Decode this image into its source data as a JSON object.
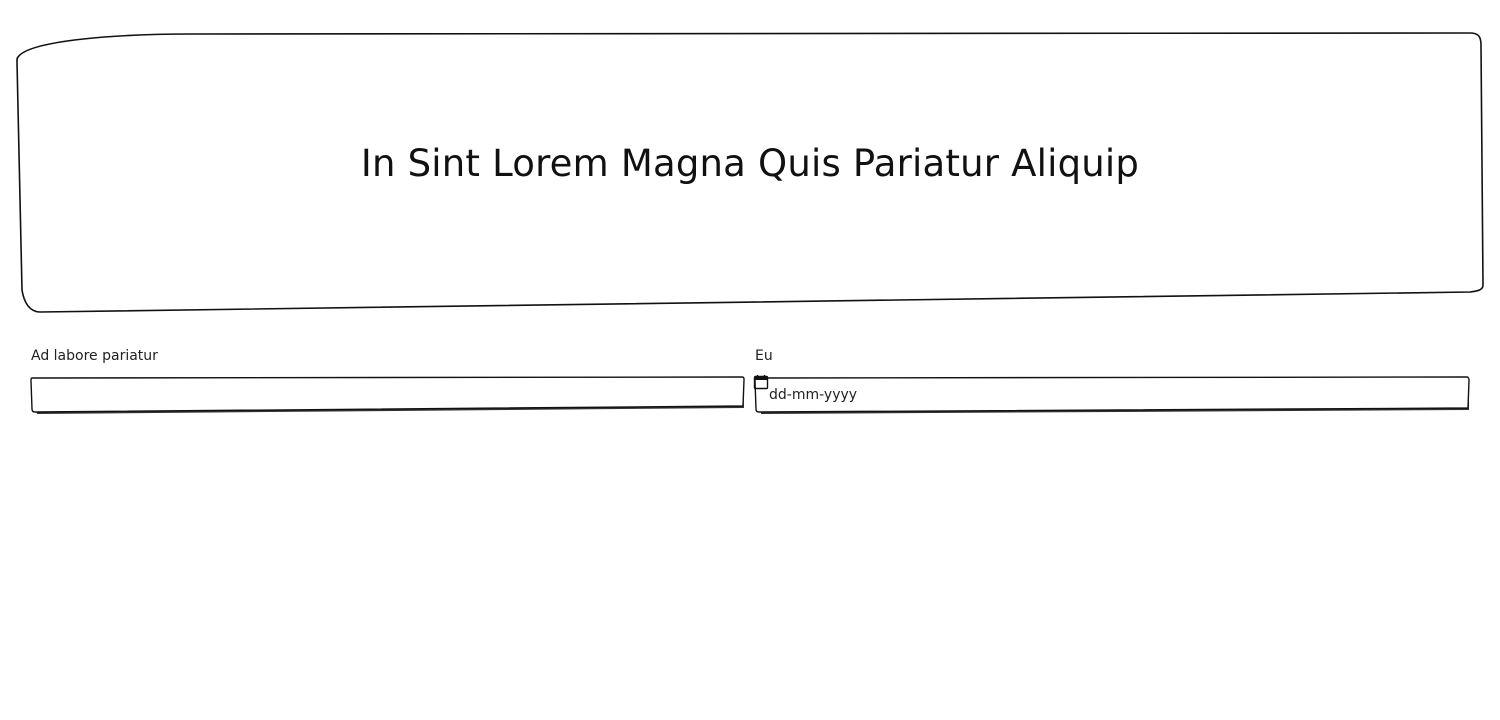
{
  "hero": {
    "title": "In Sint Lorem Magna Quis Pariatur Aliquip"
  },
  "form": {
    "fields": [
      {
        "label": "Ad labore pariatur",
        "type": "text",
        "value": ""
      },
      {
        "label": "Eu",
        "type": "date",
        "placeholder": "dd-mm-yyyy",
        "icon": "calendar-icon"
      }
    ]
  },
  "colors": {
    "stroke": "#111111",
    "background": "#ffffff",
    "shadow": "#333333"
  }
}
